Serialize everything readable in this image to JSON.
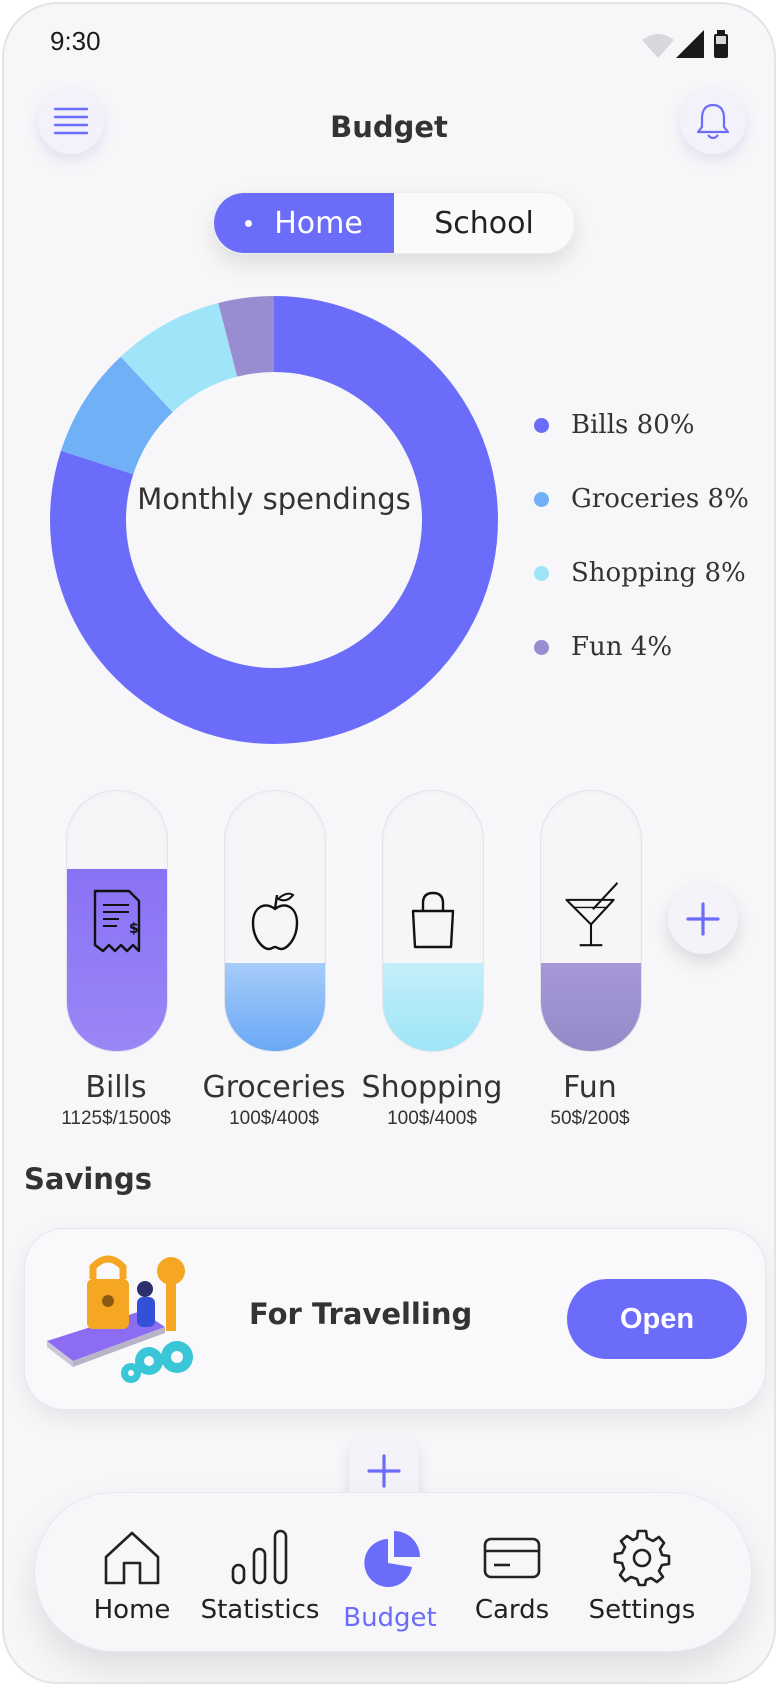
{
  "status_bar": {
    "time": "9:30"
  },
  "header": {
    "title": "Budget"
  },
  "segment": {
    "options": [
      "Home",
      "School"
    ],
    "selected": "Home"
  },
  "chart_data": {
    "type": "pie",
    "title": "Monthly spendings",
    "categories": [
      "Bills",
      "Groceries",
      "Shopping",
      "Fun"
    ],
    "values": [
      80,
      8,
      8,
      4
    ],
    "legend_labels": [
      "Bills 80%",
      "Groceries 8%",
      "Shopping 8%",
      "Fun 4%"
    ],
    "colors": [
      "#6c6cfb",
      "#6fb0f7",
      "#9fe4f8",
      "#9a8cd0"
    ],
    "legend_placement": "right"
  },
  "categories": [
    {
      "label": "Bills",
      "amount": "1125$/1500$",
      "spent": 1125,
      "limit": 1500,
      "icon": "receipt-icon",
      "color": "#8f7bf6"
    },
    {
      "label": "Groceries",
      "amount": "100$/400$",
      "spent": 100,
      "limit": 400,
      "icon": "apple-icon",
      "color": "#79b3f7"
    },
    {
      "label": "Shopping",
      "amount": "100$/400$",
      "spent": 100,
      "limit": 400,
      "icon": "shopping-bag-icon",
      "color": "#a3e6f7"
    },
    {
      "label": "Fun",
      "amount": "50$/200$",
      "spent": 50,
      "limit": 200,
      "icon": "cocktail-icon",
      "color": "#9a8cd0"
    }
  ],
  "savings": {
    "heading": "Savings",
    "card_title": "For Travelling",
    "button_label": "Open"
  },
  "nav": {
    "items": [
      {
        "label": "Home",
        "icon": "home-icon"
      },
      {
        "label": "Statistics",
        "icon": "bar-chart-icon"
      },
      {
        "label": "Budget",
        "icon": "pie-chart-icon"
      },
      {
        "label": "Cards",
        "icon": "card-icon"
      },
      {
        "label": "Settings",
        "icon": "gear-icon"
      }
    ],
    "active": "Budget"
  },
  "accent_color": "#6c6cfb"
}
